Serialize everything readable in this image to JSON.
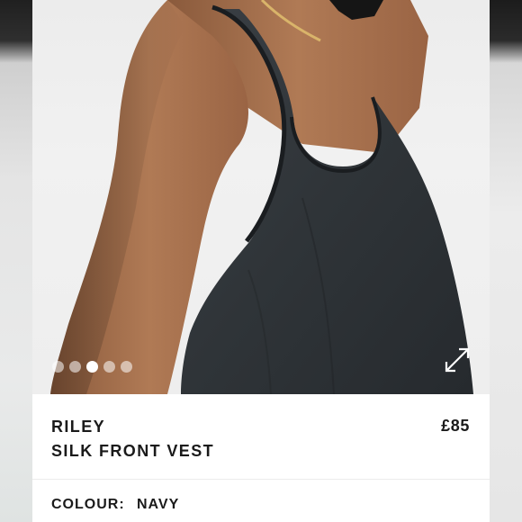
{
  "product": {
    "name_line1": "RILEY",
    "name_line2": "SILK FRONT VEST",
    "price": "£85"
  },
  "gallery": {
    "image": "model wearing navy silk front vest",
    "dots": [
      {
        "active": false
      },
      {
        "active": false
      },
      {
        "active": true
      },
      {
        "active": false
      },
      {
        "active": false
      }
    ],
    "expand_icon": "expand-arrows-icon"
  },
  "colour": {
    "label": "COLOUR:",
    "value": "NAVY"
  }
}
